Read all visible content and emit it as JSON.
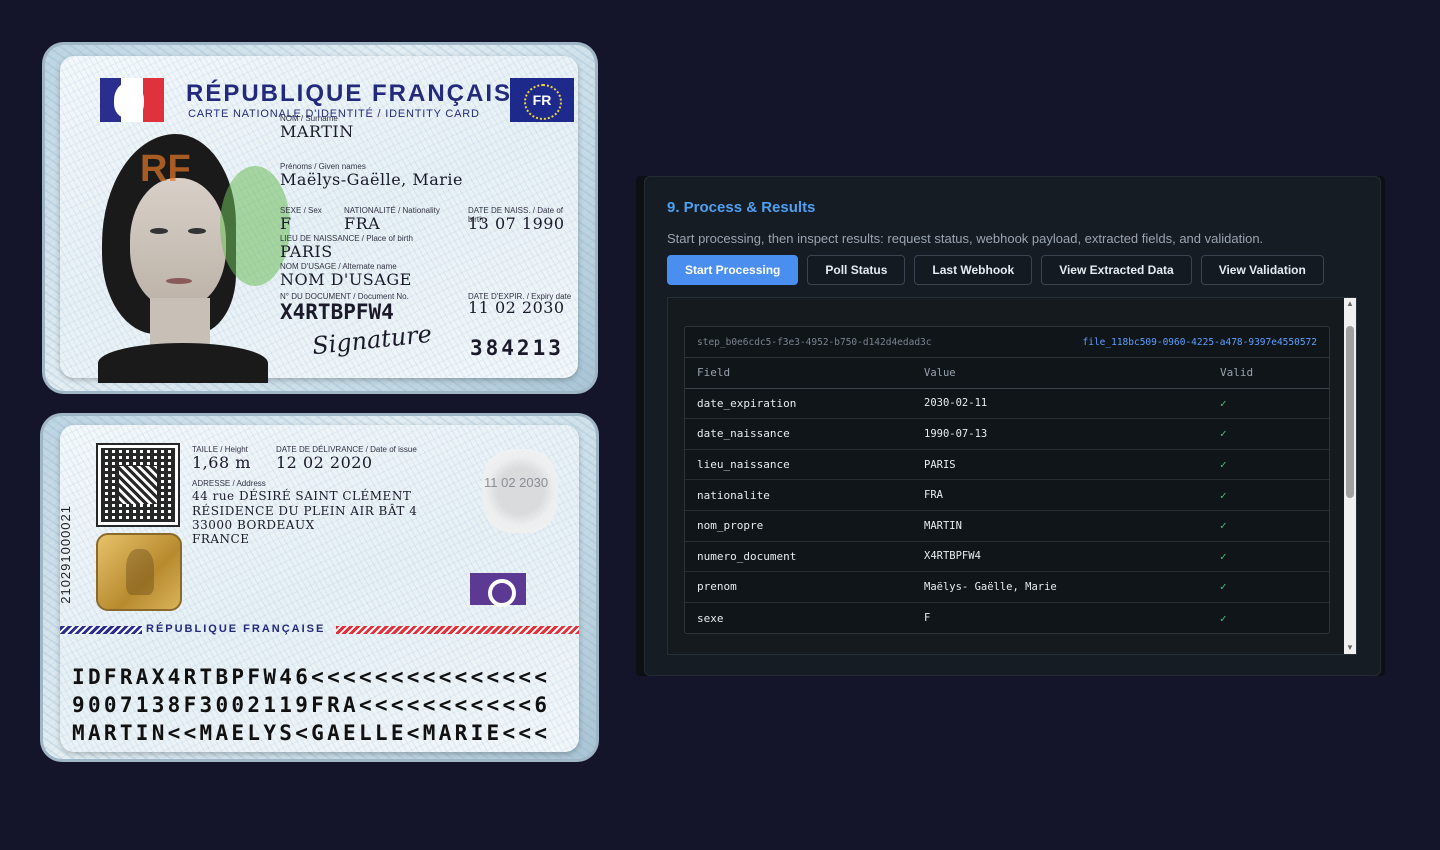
{
  "id_front": {
    "title": "RÉPUBLIQUE FRANÇAISE",
    "subtitle": "CARTE NATIONALE D'IDENTITÉ / IDENTITY CARD",
    "country_code": "FR",
    "watermark": "RF",
    "nom_label": "NOM / Surname",
    "nom": "MARTIN",
    "prenoms_label": "Prénoms / Given names",
    "prenoms": "Maëlys-Gaëlle, Marie",
    "sexe_label": "SEXE / Sex",
    "sexe": "F",
    "nationalite_label": "NATIONALITÉ / Nationality",
    "nationalite": "FRA",
    "naissance_label": "DATE DE NAISS. / Date of birth",
    "naissance": "13 07 1990",
    "lieu_label": "LIEU DE NAISSANCE / Place of birth",
    "lieu": "PARIS",
    "usage_label": "NOM D'USAGE / Alternate name",
    "usage": "NOM D'USAGE",
    "doc_label": "N° DU DOCUMENT / Document No.",
    "doc": "X4RTBPFW4",
    "expiry_label": "DATE D'EXPIR. / Expiry date",
    "expiry": "11 02 2030",
    "signature": "Signature",
    "can": "384213"
  },
  "id_back": {
    "taille_label": "TAILLE / Height",
    "taille": "1,68 m",
    "delivrance_label": "DATE DE DÉLIVRANCE / Date of issue",
    "delivrance": "12 02 2020",
    "adresse_label": "ADRESSE / Address",
    "adresse_1": "44 rue DÉSIRÉ SAINT CLÉMENT",
    "adresse_2": "RÉSIDENCE DU PLEIN AIR BÂT 4",
    "adresse_3": "33000 BORDEAUX",
    "adresse_4": "FRANCE",
    "vertical_number": "210291000021",
    "ghost_date": "11 02 2030",
    "republique": "RÉPUBLIQUE FRANÇAISE",
    "mrz_1": "IDFRAX4RTBPFW46<<<<<<<<<<<<<<<",
    "mrz_2": "9007138F3002119FRA<<<<<<<<<<<6",
    "mrz_3": "MARTIN<<MAELYS<GAELLE<MARIE<<<"
  },
  "panel": {
    "title": "9. Process & Results",
    "description": "Start processing, then inspect results: request status, webhook payload, extracted fields, and validation.",
    "buttons": {
      "start": "Start Processing",
      "poll": "Poll Status",
      "webhook": "Last Webhook",
      "extracted": "View Extracted Data",
      "validation": "View Validation"
    },
    "step_id": "step_b0e6cdc5-f3e3-4952-b750-d142d4edad3c",
    "file_id": "file_118bc509-0960-4225-a478-9397e4550572",
    "columns": {
      "field": "Field",
      "value": "Value",
      "valid": "Valid"
    },
    "rows": [
      {
        "field": "date_expiration",
        "value": "2030-02-11",
        "valid": "✓"
      },
      {
        "field": "date_naissance",
        "value": "1990-07-13",
        "valid": "✓"
      },
      {
        "field": "lieu_naissance",
        "value": "PARIS",
        "valid": "✓"
      },
      {
        "field": "nationalite",
        "value": "FRA",
        "valid": "✓"
      },
      {
        "field": "nom_propre",
        "value": "MARTIN",
        "valid": "✓"
      },
      {
        "field": "numero_document",
        "value": "X4RTBPFW4",
        "valid": "✓"
      },
      {
        "field": "prenom",
        "value": "Maëlys- Gaëlle, Marie",
        "valid": "✓"
      },
      {
        "field": "sexe",
        "value": "F",
        "valid": "✓"
      }
    ]
  },
  "colors": {
    "accent": "#4ea0f0",
    "primary_button": "#4a8ef0",
    "valid": "#40c870",
    "background": "#14142a"
  }
}
